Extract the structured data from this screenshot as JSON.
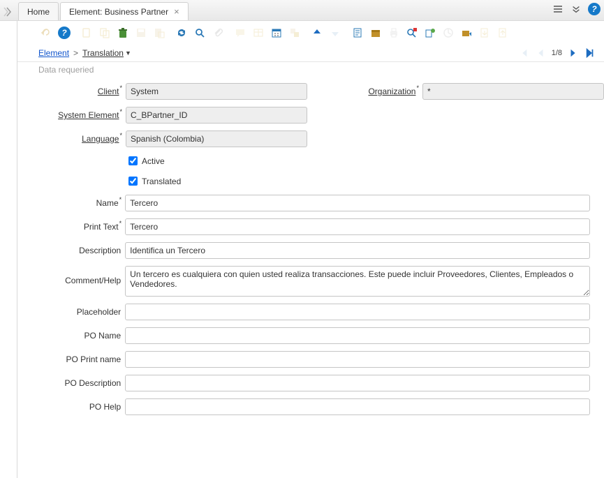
{
  "topbar": {
    "tabs": [
      {
        "label": "Home",
        "active": false
      },
      {
        "label": "Element: Business Partner",
        "active": true
      }
    ]
  },
  "breadcrumb": {
    "root": "Element",
    "current": "Translation"
  },
  "record_nav": {
    "position": "1/8"
  },
  "status": "Data requeried",
  "form": {
    "client_label": "Client",
    "client_value": "System",
    "org_label": "Organization",
    "org_value": "*",
    "sys_elem_label": "System Element",
    "sys_elem_value": "C_BPartner_ID",
    "language_label": "Language",
    "language_value": "Spanish (Colombia)",
    "active_label": "Active",
    "active_checked": true,
    "translated_label": "Translated",
    "translated_checked": true,
    "name_label": "Name",
    "name_value": "Tercero",
    "print_text_label": "Print Text",
    "print_text_value": "Tercero",
    "description_label": "Description",
    "description_value": "Identifica un Tercero",
    "comment_label": "Comment/Help",
    "comment_value": "Un tercero es cualquiera con quien usted realiza transacciones. Este puede incluir Proveedores, Clientes, Empleados o Vendedores.",
    "placeholder_label": "Placeholder",
    "placeholder_value": "",
    "po_name_label": "PO Name",
    "po_name_value": "",
    "po_print_label": "PO Print name",
    "po_print_value": "",
    "po_desc_label": "PO Description",
    "po_desc_value": "",
    "po_help_label": "PO Help",
    "po_help_value": ""
  },
  "icons": {
    "toolbar": [
      "undo-icon",
      "help-icon",
      "new-icon",
      "copy-icon",
      "delete-icon",
      "save-icon",
      "save-new-icon",
      "refresh-icon",
      "find-icon",
      "attachment-icon",
      "chat-icon",
      "grid-toggle-icon",
      "calendar-icon",
      "multi-icon",
      "parent-up-icon",
      "parent-down-icon",
      "report-icon",
      "archive-icon",
      "print-icon",
      "zoom-across-icon",
      "active-workflow-icon",
      "request-icon",
      "process-icon",
      "export-icon",
      "csv-import-icon",
      "file-import-icon"
    ]
  }
}
